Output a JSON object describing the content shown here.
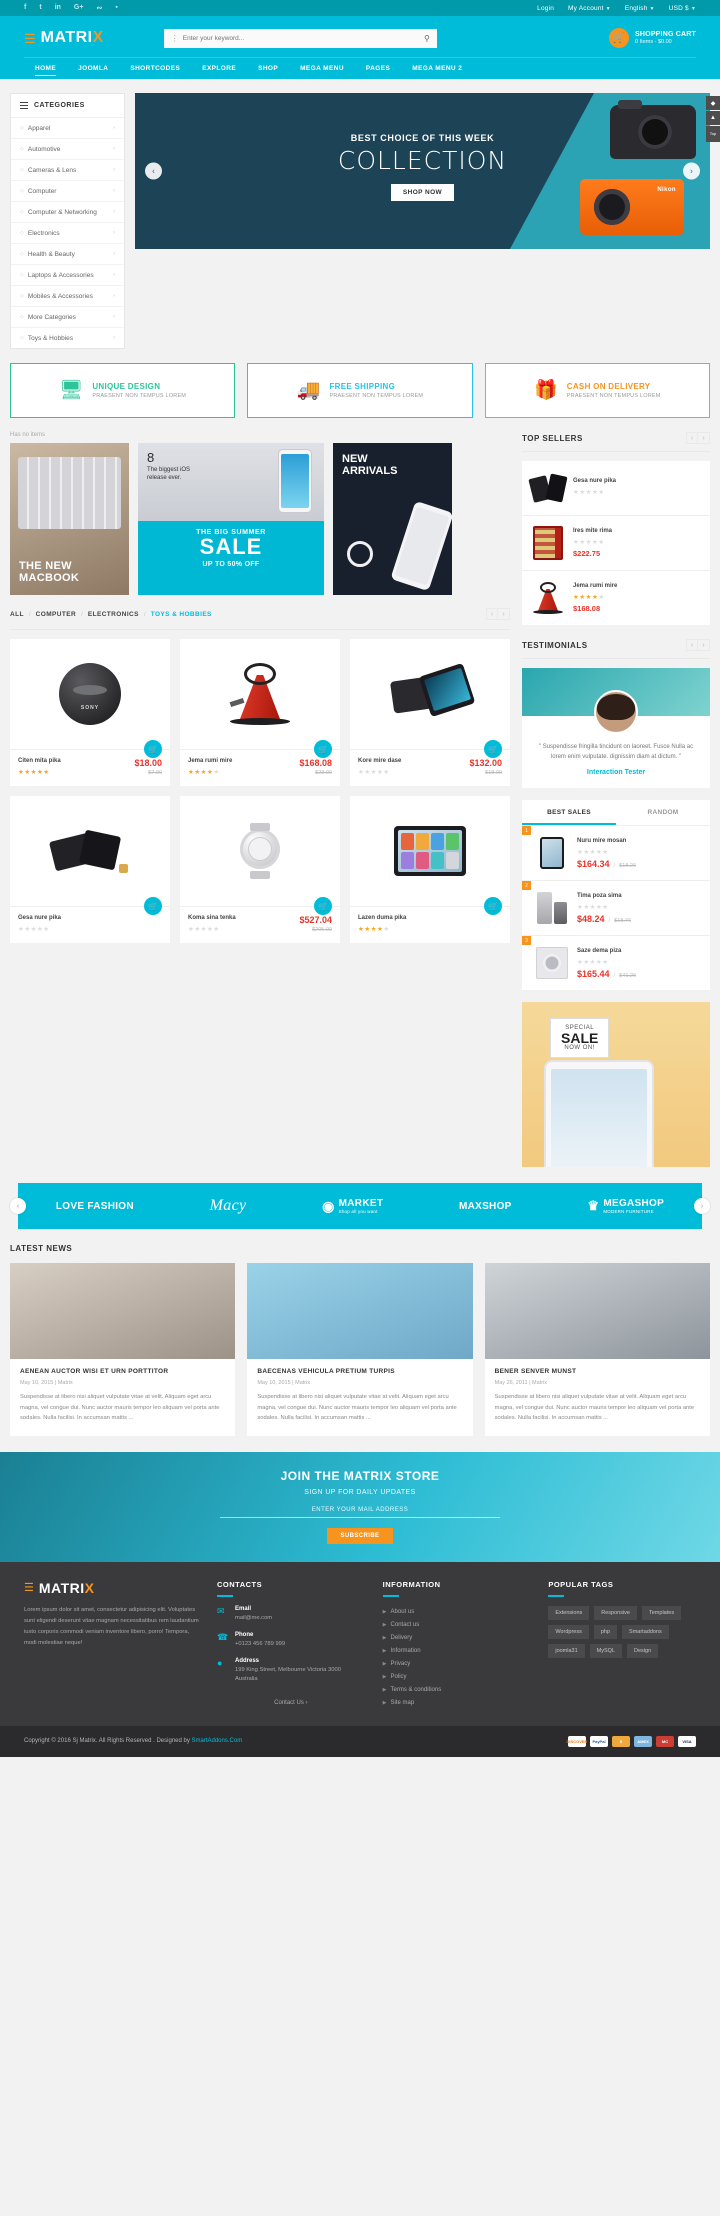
{
  "topbar": {
    "social": [
      "f",
      "t",
      "in",
      "G+",
      "rss",
      "p"
    ],
    "links": [
      "Login",
      "My Account",
      "English",
      "USD $"
    ]
  },
  "header": {
    "logo": "MATRI",
    "logo_accent": "X",
    "search_placeholder": "Enter your keyword...",
    "cart_title": "SHOPPING CART",
    "cart_sub": "0 Items - $0.00"
  },
  "nav": [
    {
      "label": "HOME",
      "active": true
    },
    {
      "label": "JOOMLA",
      "active": false
    },
    {
      "label": "SHORTCODES",
      "active": false
    },
    {
      "label": "EXPLORE",
      "active": false
    },
    {
      "label": "SHOP",
      "active": false
    },
    {
      "label": "MEGA MENU",
      "active": false
    },
    {
      "label": "PAGES",
      "active": false
    },
    {
      "label": "MEGA MENU 2",
      "active": false
    }
  ],
  "categories": {
    "title": "CATEGORIES",
    "items": [
      "Apparel",
      "Automotive",
      "Cameras & Lens",
      "Computer",
      "Computer & Networking",
      "Electronics",
      "Health & Beauty",
      "Laptops & Accessories",
      "Mobiles & Accessories",
      "More Categories",
      "Toys & Hobbies"
    ]
  },
  "slider": {
    "kicker": "BEST CHOICE OF THIS WEEK",
    "headline": "COLLECTION",
    "button": "SHOP NOW",
    "brand": "Nikon"
  },
  "features": [
    {
      "title": "UNIQUE DESIGN",
      "sub": "PRAESENT NON TEMPUS LOREM",
      "color": "#2ec49a",
      "icon": "monitor-icon"
    },
    {
      "title": "FREE SHIPPING",
      "sub": "PRAESENT NON TEMPUS LOREM",
      "color": "#28c3e8",
      "icon": "truck-icon"
    },
    {
      "title": "CASH ON DELIVERY",
      "sub": "PRAESENT NON TEMPUS LOREM",
      "color": "#f7941e",
      "icon": "gift-icon"
    }
  ],
  "promo_note": "Has no items",
  "promos": {
    "p1_caption_l1": "THE NEW",
    "p1_caption_l2": "MACBOOK",
    "p2_num": "8",
    "p2_sub": "The biggest iOS release ever.",
    "p2_b1": "THE BIG SUMMER",
    "p2_b2": "SALE",
    "p2_b3": "UP TO 50% OFF",
    "p3_l1": "NEW",
    "p3_l2": "ARRIVALS"
  },
  "filter": {
    "tabs": [
      {
        "label": "ALL",
        "on": false
      },
      {
        "label": "COMPUTER",
        "on": false
      },
      {
        "label": "ELECTRONICS",
        "on": false
      },
      {
        "label": "TOYS & HOBBIES",
        "on": true
      }
    ]
  },
  "products": [
    {
      "name": "Citen mita pika",
      "price": "$18.00",
      "old": "$7.00",
      "stars": 5,
      "brand": "SONY"
    },
    {
      "name": "Jema rumi mire",
      "price": "$168.08",
      "old": "$23.00",
      "stars": 4,
      "brand": ""
    },
    {
      "name": "Kore mire dase",
      "price": "$132.00",
      "old": "$18.00",
      "stars": 0,
      "brand": ""
    },
    {
      "name": "Gesa nure pika",
      "price": "",
      "old": "",
      "stars": 0,
      "brand": ""
    },
    {
      "name": "Koma sina tenka",
      "price": "$527.04",
      "old": "$205.00",
      "stars": 0,
      "brand": ""
    },
    {
      "name": "Lazen duma pika",
      "price": "",
      "old": "",
      "stars": 4,
      "brand": ""
    }
  ],
  "top_sellers": {
    "title": "TOP SELLERS",
    "items": [
      {
        "name": "Gesa nure pika",
        "price": "",
        "stars": 0
      },
      {
        "name": "Ires mite rima",
        "price": "$222.75",
        "stars": 0
      },
      {
        "name": "Jema rumi mire",
        "price": "$168.08",
        "stars": 4
      }
    ]
  },
  "testimonials": {
    "title": "TESTIMONIALS",
    "quote": "\" Suspendisse fringilla tincidunt on laoreet. Fusce Nulla ac lorem enim vulputate. dignissim diam at dictum. \"",
    "author": "Interaction Tester"
  },
  "tabs_widget": {
    "tabs": [
      {
        "label": "BEST SALES",
        "on": true
      },
      {
        "label": "RANDOM",
        "on": false
      }
    ],
    "items": [
      {
        "rank": "1",
        "name": "Nuru mire mosan",
        "price": "$164.34",
        "old": "$18.26",
        "stars": 0
      },
      {
        "rank": "2",
        "name": "Tima poza sima",
        "price": "$48.24",
        "old": "$18.76",
        "stars": 0
      },
      {
        "rank": "3",
        "name": "Saze dema piza",
        "price": "$165.44",
        "old": "$41.26",
        "stars": 0
      }
    ]
  },
  "sale_banner": {
    "l1": "SPECIAL",
    "l2": "SALE",
    "l3": "NOW ON!"
  },
  "brands": [
    {
      "name": "LOVE FASHION",
      "style": "plain",
      "sub": ""
    },
    {
      "name": "Macy",
      "style": "script",
      "sub": ""
    },
    {
      "name": "MARKET",
      "style": "icon",
      "sub": "Shop all you want"
    },
    {
      "name": "MAXSHOP",
      "style": "plain",
      "sub": ""
    },
    {
      "name": "MEGASHOP",
      "style": "icon",
      "sub": "MODERN FURNITURE"
    }
  ],
  "news": {
    "title": "LATEST NEWS",
    "items": [
      {
        "title": "AENEAN AUCTOR WISI ET URN PORTTITOR",
        "date": "May 10, 2015 | Matrix",
        "text": "Suspendisse at libero nisi aliquet vulputate vitae at velit. Aliquam eget arcu magna, vel congue dui. Nunc auctor mauris tempor leo aliquam vel porta ante sodales. Nulla facilisi. In accumsan mattis ..."
      },
      {
        "title": "BAECENAS VEHICULA PRETIUM TURPIS",
        "date": "May 10, 2015 | Matrix",
        "text": "Suspendisse at libero nisi aliquet vulputate vitae at velit. Aliquam eget arcu magna, vel congue dui. Nunc auctor mauris tempor leo aliquam vel porta ante sodales. Nulla facilisi. In accumsan mattis ..."
      },
      {
        "title": "BENER SENVER MUNST",
        "date": "May 26, 2011 | Matrix",
        "text": "Suspendisse at libero nisi aliquet vulputate vitae at velit. Aliquam eget arcu magna, vel congue dui. Nunc auctor mauris tempor leo aliquam vel porta ante sodales. Nulla facilisi. In accumsan mattis ..."
      }
    ]
  },
  "newsletter": {
    "title": "JOIN THE MATRIX STORE",
    "subtitle": "SIGN UP FOR DAILY UPDATES",
    "placeholder": "ENTER YOUR MAIL ADDRESS",
    "button": "SUBSCRIBE"
  },
  "footer": {
    "logo": "MATRI",
    "logo_accent": "X",
    "about": "Lorem ipsum dolor sit amet, consectetur adipisicing elit. Voluptates sunt eligendi deserunt vitae magnam necessitatibus rem laudantium iusto corporis commodi veniam inventore libero, porro! Tempora, modi molestiae neque!",
    "contacts_title": "CONTACTS",
    "contacts": [
      {
        "icon": "mail-icon",
        "label": "Email",
        "value": "mail@me.com"
      },
      {
        "icon": "phone-icon",
        "label": "Phone",
        "value": "+0123 456 789 999"
      },
      {
        "icon": "pin-icon",
        "label": "Address",
        "value": "199 King Street, Melbourne Victoria 3000 Australia"
      }
    ],
    "information_title": "INFORMATION",
    "information": [
      "About us",
      "Contact us",
      "Delivery",
      "Information",
      "Privacy",
      "Policy",
      "Terms & conditions",
      "Site map"
    ],
    "tags_title": "POPULAR TAGS",
    "tags": [
      "Extensions",
      "Responsive",
      "Templates",
      "Wordpress",
      "php",
      "Smartaddons",
      "joomla31",
      "MySQL",
      "Design"
    ],
    "contact_us": "Contact Us"
  },
  "copyright": {
    "text": "Copyright © 2016 Sj Matrix. All Rights Reserved . Designed by ",
    "link": "SmartAddons.Com",
    "payments": [
      "DISCOVER",
      "PayPal",
      "S",
      "AMEX",
      "MC",
      "VISA"
    ]
  },
  "dock": [
    "share-icon",
    "up-icon",
    "Top"
  ]
}
